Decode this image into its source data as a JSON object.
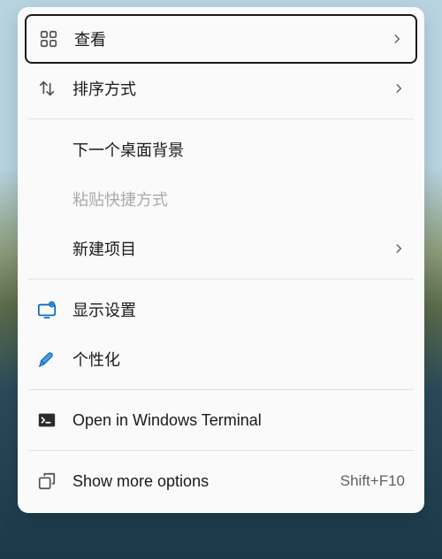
{
  "menu": {
    "items": [
      {
        "label": "查看"
      },
      {
        "label": "排序方式"
      },
      {
        "label": "下一个桌面背景"
      },
      {
        "label": "粘贴快捷方式"
      },
      {
        "label": "新建项目"
      },
      {
        "label": "显示设置"
      },
      {
        "label": "个性化"
      },
      {
        "label": "Open in Windows Terminal"
      },
      {
        "label": "Show more options",
        "shortcut": "Shift+F10"
      }
    ]
  }
}
